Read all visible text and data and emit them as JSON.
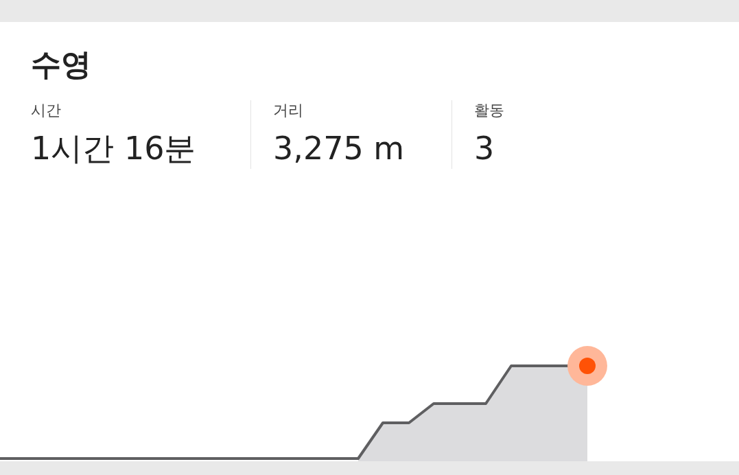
{
  "title": "수영",
  "stats": [
    {
      "label": "시간",
      "value": "1시간 16분"
    },
    {
      "label": "거리",
      "value": "3,275 m"
    },
    {
      "label": "활동",
      "value": "3"
    }
  ]
}
